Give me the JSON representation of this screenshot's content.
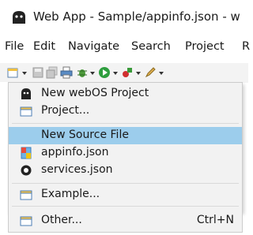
{
  "window": {
    "title": "Web App - Sample/appinfo.json - w"
  },
  "menubar": {
    "items": [
      {
        "label": "File"
      },
      {
        "label": "Edit"
      },
      {
        "label": "Navigate"
      },
      {
        "label": "Search"
      },
      {
        "label": "Project"
      },
      {
        "label": "R"
      }
    ]
  },
  "dropdown": {
    "items": [
      {
        "label": "New webOS Project",
        "icon": "webos-project-icon"
      },
      {
        "label": "Project...",
        "icon": "project-icon"
      },
      {
        "label": "New Source File",
        "icon": "",
        "selected": true
      },
      {
        "label": "appinfo.json",
        "icon": "json-file-icon"
      },
      {
        "label": "services.json",
        "icon": "services-icon"
      },
      {
        "label": "Example...",
        "icon": "example-icon"
      },
      {
        "label": "Other...",
        "icon": "other-wizard-icon",
        "shortcut": "Ctrl+N"
      }
    ]
  },
  "colors": {
    "selection": "#9ccdec",
    "menu_bg": "#f2f2f2",
    "toolbar_bg": "#f3f3f3"
  }
}
